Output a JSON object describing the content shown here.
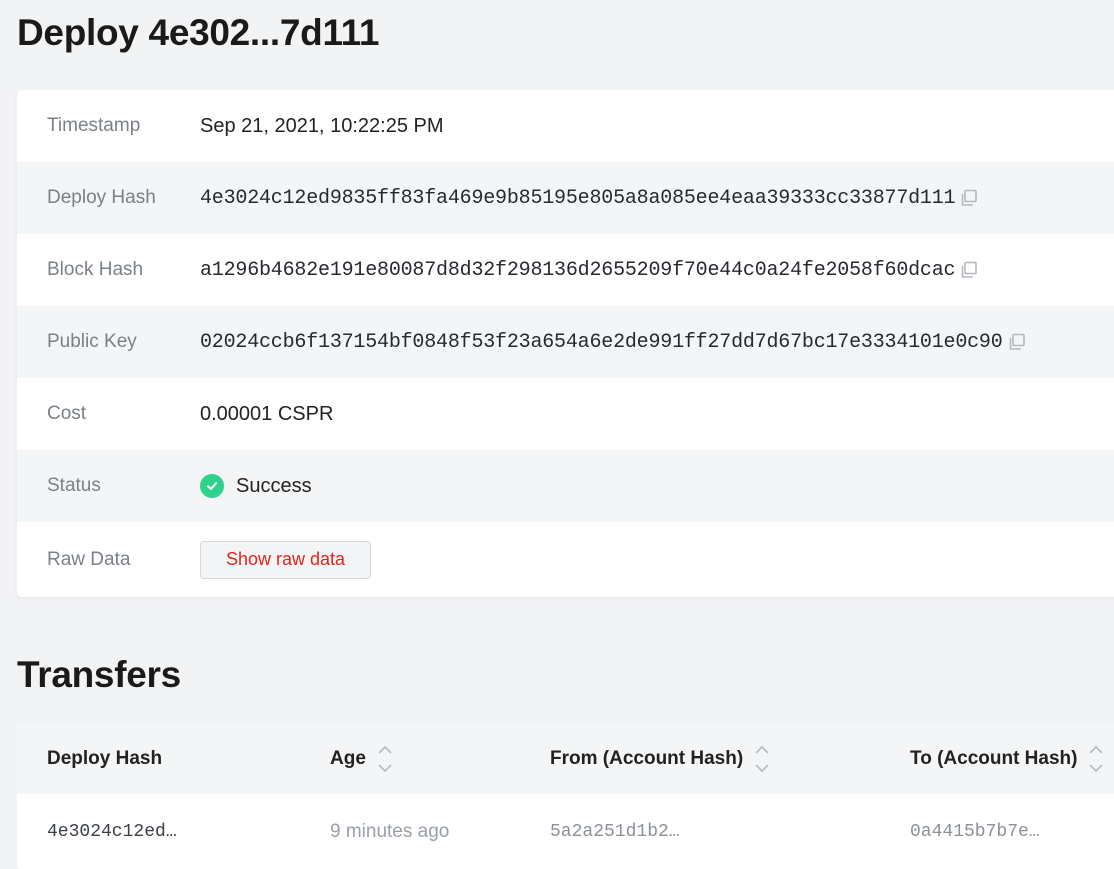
{
  "page": {
    "title": "Deploy 4e302...7d111"
  },
  "details": {
    "timestamp": {
      "label": "Timestamp",
      "value": "Sep 21, 2021, 10:22:25 PM"
    },
    "deploy_hash": {
      "label": "Deploy Hash",
      "value": "4e3024c12ed9835ff83fa469e9b85195e805a8a085ee4eaa39333cc33877d111",
      "icon": "copy-icon"
    },
    "block_hash": {
      "label": "Block Hash",
      "value": "a1296b4682e191e80087d8d32f298136d2655209f70e44c0a24fe2058f60dcac",
      "icon": "copy-icon"
    },
    "public_key": {
      "label": "Public Key",
      "value": "02024ccb6f137154bf0848f53f23a654a6e2de991ff27dd7d67bc17e3334101e0c90",
      "icon": "copy-icon"
    },
    "cost": {
      "label": "Cost",
      "value": "0.00001 CSPR"
    },
    "status": {
      "label": "Status",
      "value": "Success",
      "icon": "check-circle-icon",
      "color": "#2fd28a"
    },
    "raw_data": {
      "label": "Raw Data",
      "button_label": "Show raw data",
      "button_color": "#e0261c"
    }
  },
  "transfers": {
    "title": "Transfers",
    "columns": [
      {
        "label": "Deploy Hash",
        "sortable": false
      },
      {
        "label": "Age",
        "sortable": true
      },
      {
        "label": "From (Account Hash)",
        "sortable": true
      },
      {
        "label": "To (Account Hash)",
        "sortable": true
      }
    ],
    "rows": [
      {
        "deploy_hash": "4e3024c12ed…",
        "age": "9 minutes ago",
        "from": "5a2a251d1b2…",
        "to": "0a4415b7b7e…"
      }
    ]
  }
}
